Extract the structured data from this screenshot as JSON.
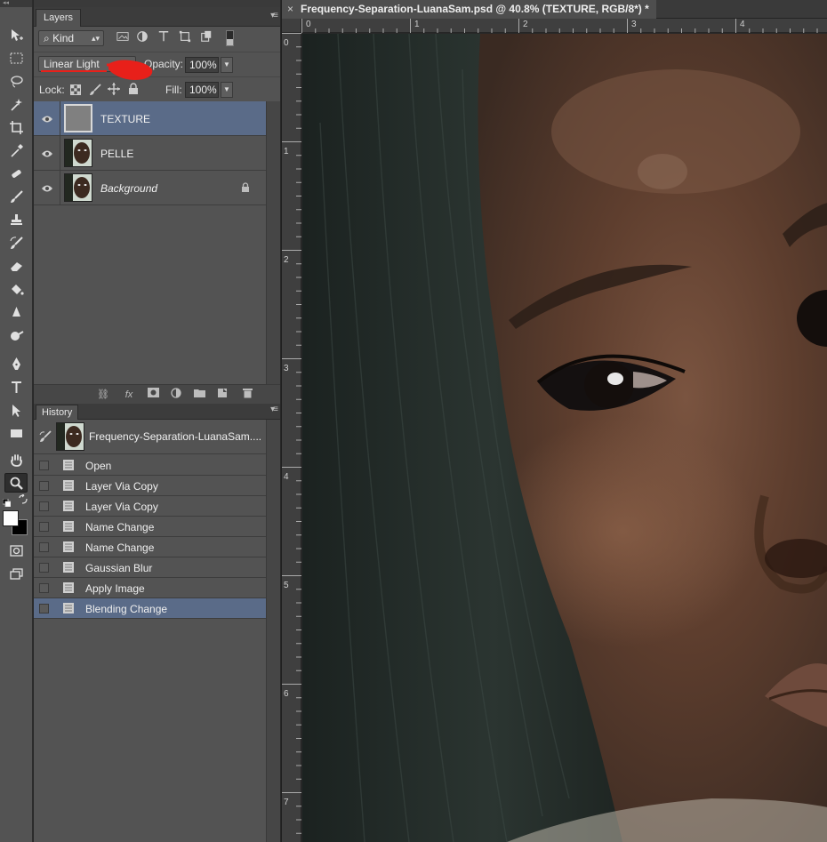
{
  "app": {
    "name": "Photoshop"
  },
  "toolbar": {
    "tools": [
      "move-tool",
      "marquee-tool",
      "lasso-tool",
      "quick-select-tool",
      "crop-tool",
      "eyedropper-tool",
      "spot-heal-tool",
      "brush-tool",
      "clone-stamp-tool",
      "history-brush-tool",
      "eraser-tool",
      "paint-bucket-tool",
      "blur-tool",
      "dodge-tool",
      "pen-tool",
      "type-tool",
      "path-select-tool",
      "shape-tool",
      "hand-tool",
      "zoom-tool"
    ],
    "active_tool": "zoom-tool",
    "foreground_color": "#ffffff",
    "background_color": "#000000"
  },
  "layers_panel": {
    "tab_label": "Layers",
    "filter_kind": "Kind",
    "blend_mode": "Linear Light",
    "opacity_label": "Opacity:",
    "opacity_value": "100%",
    "lock_label": "Lock:",
    "fill_label": "Fill:",
    "fill_value": "100%",
    "layers": [
      {
        "name": "TEXTURE",
        "selected": true,
        "thumb": "grey",
        "locked": false
      },
      {
        "name": "PELLE",
        "selected": false,
        "thumb": "portrait",
        "locked": false
      },
      {
        "name": "Background",
        "selected": false,
        "thumb": "portrait",
        "locked": true,
        "italic": true
      }
    ]
  },
  "history_panel": {
    "tab_label": "History",
    "snapshot_name": "Frequency-Separation-LuanaSam....",
    "items": [
      {
        "label": "Open"
      },
      {
        "label": "Layer Via Copy"
      },
      {
        "label": "Layer Via Copy"
      },
      {
        "label": "Name Change"
      },
      {
        "label": "Name Change"
      },
      {
        "label": "Gaussian Blur"
      },
      {
        "label": "Apply Image"
      },
      {
        "label": "Blending Change",
        "selected": true
      }
    ]
  },
  "document": {
    "tab_title": "Frequency-Separation-LuanaSam.psd @ 40.8% (TEXTURE, RGB/8*) *",
    "close_glyph": "×",
    "ruler_h": [
      "0",
      "1",
      "2",
      "3",
      "4"
    ],
    "ruler_v": [
      "0",
      "1",
      "2",
      "3",
      "4",
      "5",
      "6",
      "7"
    ]
  },
  "colors": {
    "panel_bg": "#535353",
    "selection": "#5a6b88",
    "annotation_red": "#e8201a"
  }
}
